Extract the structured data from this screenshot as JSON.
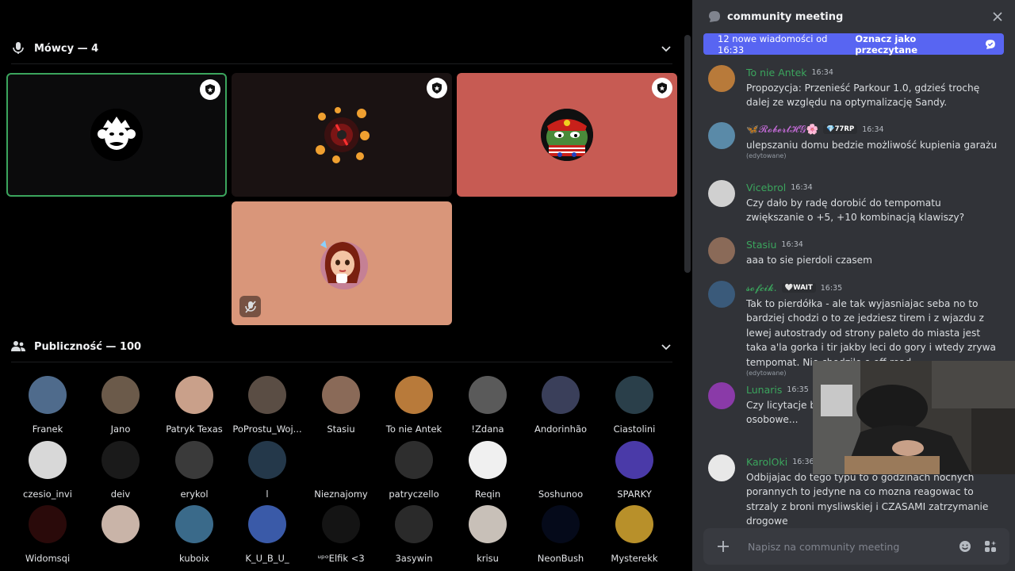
{
  "speakers": {
    "header": "Mówcy — 4",
    "tiles": [
      {
        "bg": "#0b0b0c",
        "border": "#3ba55d",
        "avatar": "monkey-avatar",
        "moderator": true,
        "muted": false
      },
      {
        "bg": "#1a1212",
        "border": "",
        "avatar": "orbs-avatar",
        "moderator": true,
        "muted": false
      },
      {
        "bg": "#c75b53",
        "border": "",
        "avatar": "frog-avatar",
        "moderator": true,
        "muted": false
      },
      {
        "bg": "#d9967a",
        "border": "",
        "avatar": "girl-avatar",
        "moderator": false,
        "muted": true
      }
    ]
  },
  "audience": {
    "header": "Publiczność — 100",
    "members": [
      {
        "name": "Franek",
        "color": "#4f6b8c"
      },
      {
        "name": "Jano",
        "color": "#6b5a4a"
      },
      {
        "name": "Patryk Texas",
        "color": "#c9a08a"
      },
      {
        "name": "PoProstu_Woj...",
        "color": "#5a4d44"
      },
      {
        "name": "Stasiu",
        "color": "#8a6a58"
      },
      {
        "name": "To nie Antek",
        "color": "#b87a3a"
      },
      {
        "name": "!Zdana",
        "color": "#5a5a5a"
      },
      {
        "name": "Andorinhão",
        "color": "#3a3f5a"
      },
      {
        "name": "Ciastolini",
        "color": "#2a3f4a"
      },
      {
        "name": "czesio_invi",
        "color": "#d8d8d8"
      },
      {
        "name": "deiv",
        "color": "#1a1a1a"
      },
      {
        "name": "erykol",
        "color": "#3a3a3a"
      },
      {
        "name": "l",
        "color": "#24384a"
      },
      {
        "name": "Nieznajomy",
        "color": "#000000"
      },
      {
        "name": "patryczello",
        "color": "#2e2e2e"
      },
      {
        "name": "Reqin",
        "color": "#f0f0f0"
      },
      {
        "name": "Soshunoo",
        "color": "#000000"
      },
      {
        "name": "SPARKY",
        "color": "#4a3aa8"
      },
      {
        "name": "Widomsqi",
        "color": "#2a0a0a"
      },
      {
        "name": "",
        "color": "#c9b4a8"
      },
      {
        "name": "kuboix",
        "color": "#3a6a8a"
      },
      {
        "name": "K_U_B_U_",
        "color": "#3a5aa8"
      },
      {
        "name": "ᵘᵖᵒElfik <3",
        "color": "#141414"
      },
      {
        "name": "3asywin",
        "color": "#2a2a2a"
      },
      {
        "name": "krisu",
        "color": "#c8c0b8"
      },
      {
        "name": "NeonBush",
        "color": "#050a1a"
      },
      {
        "name": "Mysterekk",
        "color": "#b8902a"
      }
    ]
  },
  "chat": {
    "title": "community meeting",
    "banner_text": "12 nowe wiadomości od 16:33",
    "banner_action": "Oznacz jako przeczytane",
    "composer_placeholder": "Napisz na community meeting",
    "messages": [
      {
        "user": "To nie Antek",
        "time": "16:34",
        "tag": "",
        "text": "Propozycja: Przenieść Parkour 1.0, gdzieś trochę dalej ze względu na optymalizację Sandy.",
        "edited": "",
        "color": "#b87a3a",
        "user_color": "#3ba55d"
      },
      {
        "user": "🦋𝓡𝓸𝓫𝓮𝓻𝓽𝓗𝓖🌸",
        "time": "16:34",
        "tag": "💎77RP",
        "text": "ulepszaniu domu bedzie możliwość kupienia garażu",
        "edited": "(edytowane)",
        "color": "#5a8aa8",
        "user_color": "#c36bd6"
      },
      {
        "user": "Vicebrol",
        "time": "16:34",
        "tag": "",
        "text": "Czy dało by radę dorobić do tempomatu zwiększanie o +5, +10 kombinacją klawiszy?",
        "edited": "",
        "color": "#d0d0d0",
        "user_color": "#3ba55d"
      },
      {
        "user": "Stasiu",
        "time": "16:34",
        "tag": "",
        "text": "aaa to sie pierdoli czasem",
        "edited": "",
        "color": "#8a6a58",
        "user_color": "#3ba55d"
      },
      {
        "user": "𝓼𝓸𝓯𝓬𝓲𝓴.",
        "time": "16:35",
        "tag": "🤍WAIT",
        "text": "Tak to pierdółka - ale tak wyjasniajac seba no to bardziej chodzi o to ze jedziesz tirem i z wjazdu z lewej autostrady od strony paleto do miasta jest taka a'la gorka i tir jakby leci do gory i wtedy zrywa tempomat. Nie chodziło o off-road",
        "edited": "(edytowane)",
        "color": "#3a5a7a",
        "user_color": "#3ba55d"
      },
      {
        "user": "Lunaris",
        "time": "16:35",
        "tag": "",
        "text": "Czy licytacje będą... z tego co słysza... ok. 10-osobowe...",
        "edited": "",
        "color": "#8a3aa8",
        "user_color": "#3ba55d"
      },
      {
        "user": "KarolOki",
        "time": "16:36",
        "tag": "",
        "text": "Odbijajac do tego typu to o godzinach nocnych porannych to jedyne na co mozna reagowac to strzaly z broni mysliwskiej i CZASAMI zatrzymanie drogowe",
        "edited": "",
        "color": "#e8e8e8",
        "user_color": "#3ba55d"
      }
    ]
  }
}
